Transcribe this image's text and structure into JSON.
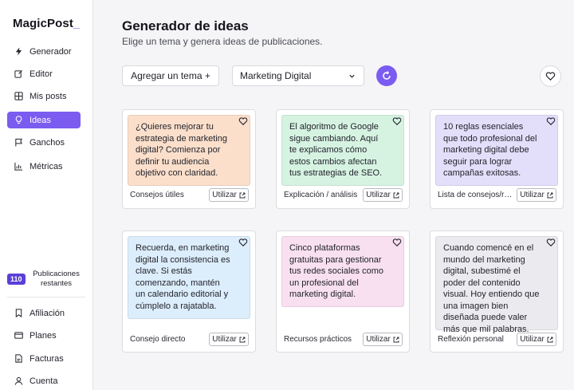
{
  "app": {
    "logo": "MagicPost",
    "logo_cursor": "_"
  },
  "sidebar": {
    "items": [
      {
        "label": "Generador",
        "icon": "bolt-icon"
      },
      {
        "label": "Editor",
        "icon": "edit-icon"
      },
      {
        "label": "Mis posts",
        "icon": "grid-icon"
      },
      {
        "label": "Ideas",
        "icon": "lightbulb-icon",
        "active": true
      },
      {
        "label": "Ganchos",
        "icon": "flag-icon"
      },
      {
        "label": "Métricas",
        "icon": "chart-icon"
      }
    ],
    "publications": {
      "count": "110",
      "label": "Publicaciones restantes"
    },
    "bottom_items": [
      {
        "label": "Afiliación",
        "icon": "bookmark-icon"
      },
      {
        "label": "Planes",
        "icon": "card-icon"
      },
      {
        "label": "Facturas",
        "icon": "invoice-icon"
      },
      {
        "label": "Cuenta",
        "icon": "user-icon"
      }
    ]
  },
  "header": {
    "title": "Generador de ideas",
    "subtitle": "Elige un tema y genera ideas de publicaciones."
  },
  "toolbar": {
    "add_topic_label": "Agregar un tema +",
    "topic_selected": "Marketing Digital"
  },
  "colors": {
    "accent": "#7b5cf0",
    "card_orange": "#fbdfcb",
    "card_green": "#d6f3e2",
    "card_purple": "#e3defa",
    "card_blue": "#dcedfb",
    "card_pink": "#f8e0f1",
    "card_gray": "#ebebef"
  },
  "use_label": "Utilizar",
  "cards": [
    {
      "text": "¿Quieres mejorar tu estrategia de marketing digital? Comienza por definir tu audiencia objetivo con claridad.",
      "category": "Consejos útiles",
      "color": "#fbdfcb"
    },
    {
      "text": "El algoritmo de Google sigue cambiando. Aquí te explicamos cómo estos cambios afectan tus estrategias de SEO.",
      "category": "Explicación / análisis",
      "color": "#d6f3e2"
    },
    {
      "text": "10 reglas esenciales que todo profesional del marketing digital debe seguir para lograr campañas exitosas.",
      "category": "Lista de consejos/re...",
      "color": "#e3defa"
    },
    {
      "text": "Recuerda, en marketing digital la consistencia es clave. Si estás comenzando, mantén un calendario editorial y cúmplelo a rajatabla.",
      "category": "Consejo directo",
      "color": "#dcedfb"
    },
    {
      "text": "Cinco plataformas gratuitas para gestionar tus redes sociales como un profesional del marketing digital.",
      "category": "Recursos prácticos",
      "color": "#f8e0f1"
    },
    {
      "text": "Cuando comencé en el mundo del marketing digital, subestimé el poder del contenido visual. Hoy entiendo que una imagen bien diseñada puede valer más que mil palabras.",
      "category": "Reflexión personal",
      "color": "#ebebef"
    }
  ]
}
